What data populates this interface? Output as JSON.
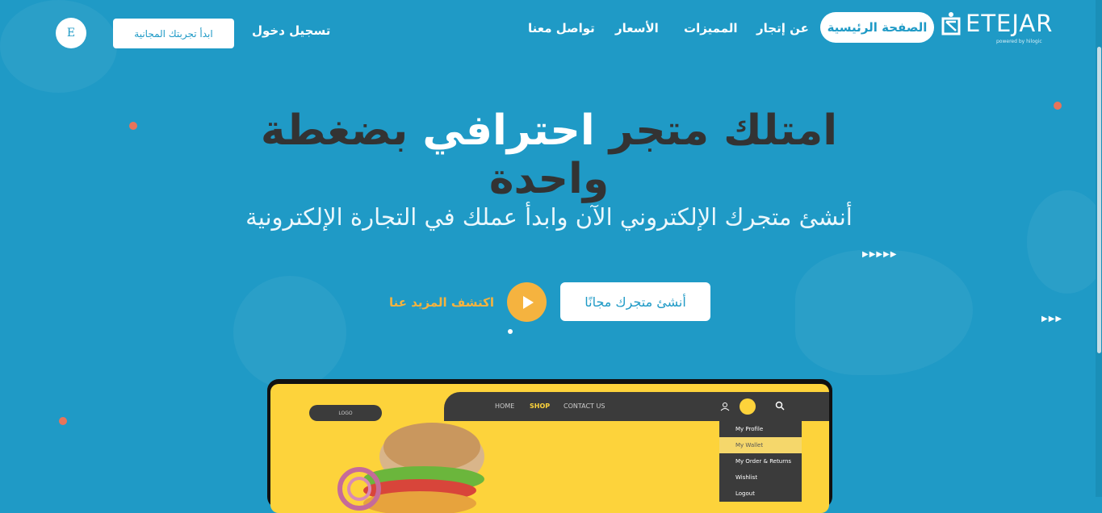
{
  "header": {
    "logo_text": "ETEJAR",
    "logo_sub": "powered by hilogic",
    "nav": {
      "home": "الصفحة الرئيسية",
      "about": "عن إتجار",
      "features": "المميزات",
      "prices": "الأسعار",
      "contact": "تواصل معنا"
    },
    "trial_button": "ابدأ تجربتك المجانية",
    "login": "تسجيل دخول",
    "lang": "E"
  },
  "hero": {
    "title_part1": "امتلك متجر ",
    "title_highlight": "احترافي",
    "title_part2": " بضغطة واحدة",
    "subtitle": "أنشئ متجرك الإلكتروني الآن وابدأ عملك في التجارة الإلكترونية",
    "create_button": "أنشئ متجرك مجانًا",
    "more_link": "اكتشف المزيد عنا"
  },
  "mockup": {
    "logo": "LOGO",
    "nav_home": "HOME",
    "nav_shop": "SHOP",
    "nav_contact": "CONTACT US",
    "menu": [
      "My Profile",
      "My Wallet",
      "My Order & Returns",
      "Wishlist",
      "Logout"
    ]
  },
  "colors": {
    "background": "#1f9ac6",
    "accent": "#f5b33f",
    "title_dark": "#333333",
    "dot": "#e8745a"
  },
  "icons": [
    "logo-icon",
    "play-icon",
    "user-icon",
    "search-icon"
  ]
}
